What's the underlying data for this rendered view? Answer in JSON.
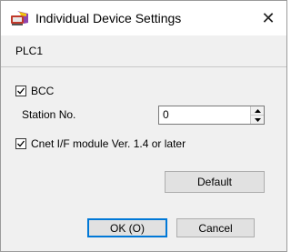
{
  "window": {
    "title": "Individual Device Settings",
    "close_label": "✕"
  },
  "device": {
    "name": "PLC1"
  },
  "options": {
    "bcc": {
      "label": "BCC",
      "checked": true
    },
    "station": {
      "label": "Station No.",
      "value": "0"
    },
    "cnet": {
      "label": "Cnet I/F module Ver. 1.4 or later",
      "checked": true
    }
  },
  "buttons": {
    "default_label": "Default",
    "ok_label": "OK (O)",
    "cancel_label": "Cancel"
  },
  "icons": {
    "app": "device-settings-icon",
    "close": "close-icon",
    "check": "check-icon",
    "spin_up": "spin-up-arrow-icon",
    "spin_down": "spin-down-arrow-icon"
  },
  "colors": {
    "dialog_bg": "#f0f0f0",
    "titlebar_bg": "#ffffff",
    "button_bg": "#e1e1e1",
    "focus_border": "#0078d7"
  }
}
